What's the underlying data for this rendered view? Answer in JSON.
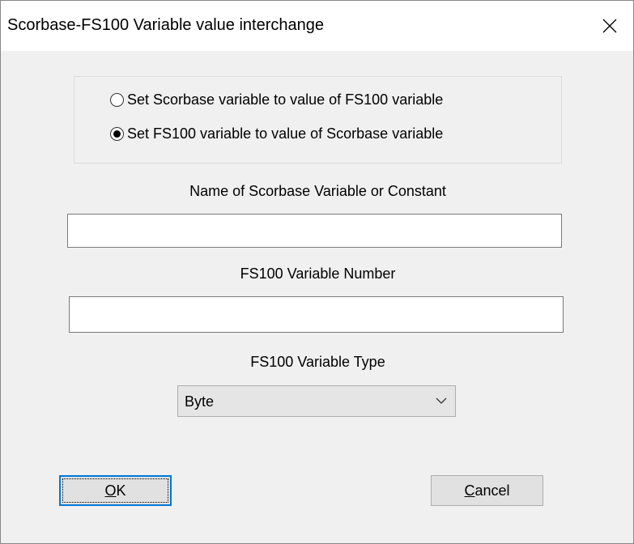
{
  "window": {
    "title": "Scorbase-FS100 Variable value interchange",
    "close_icon": "close-icon"
  },
  "direction_group": {
    "options": [
      {
        "label": "Set Scorbase variable to value of FS100 variable",
        "selected": false
      },
      {
        "label": "Set FS100 variable to value of Scorbase variable",
        "selected": true
      }
    ]
  },
  "scorbase_variable": {
    "label": "Name of Scorbase Variable or Constant",
    "value": ""
  },
  "fs100_number": {
    "label": "FS100 Variable Number",
    "value": ""
  },
  "fs100_type": {
    "label": "FS100 Variable Type",
    "selected": "Byte"
  },
  "buttons": {
    "ok_mnemonic": "O",
    "ok_rest": "K",
    "cancel_mnemonic": "C",
    "cancel_rest": "ancel"
  },
  "colors": {
    "dialog_bg": "#f0f0f0",
    "focus_border": "#0078d7"
  }
}
